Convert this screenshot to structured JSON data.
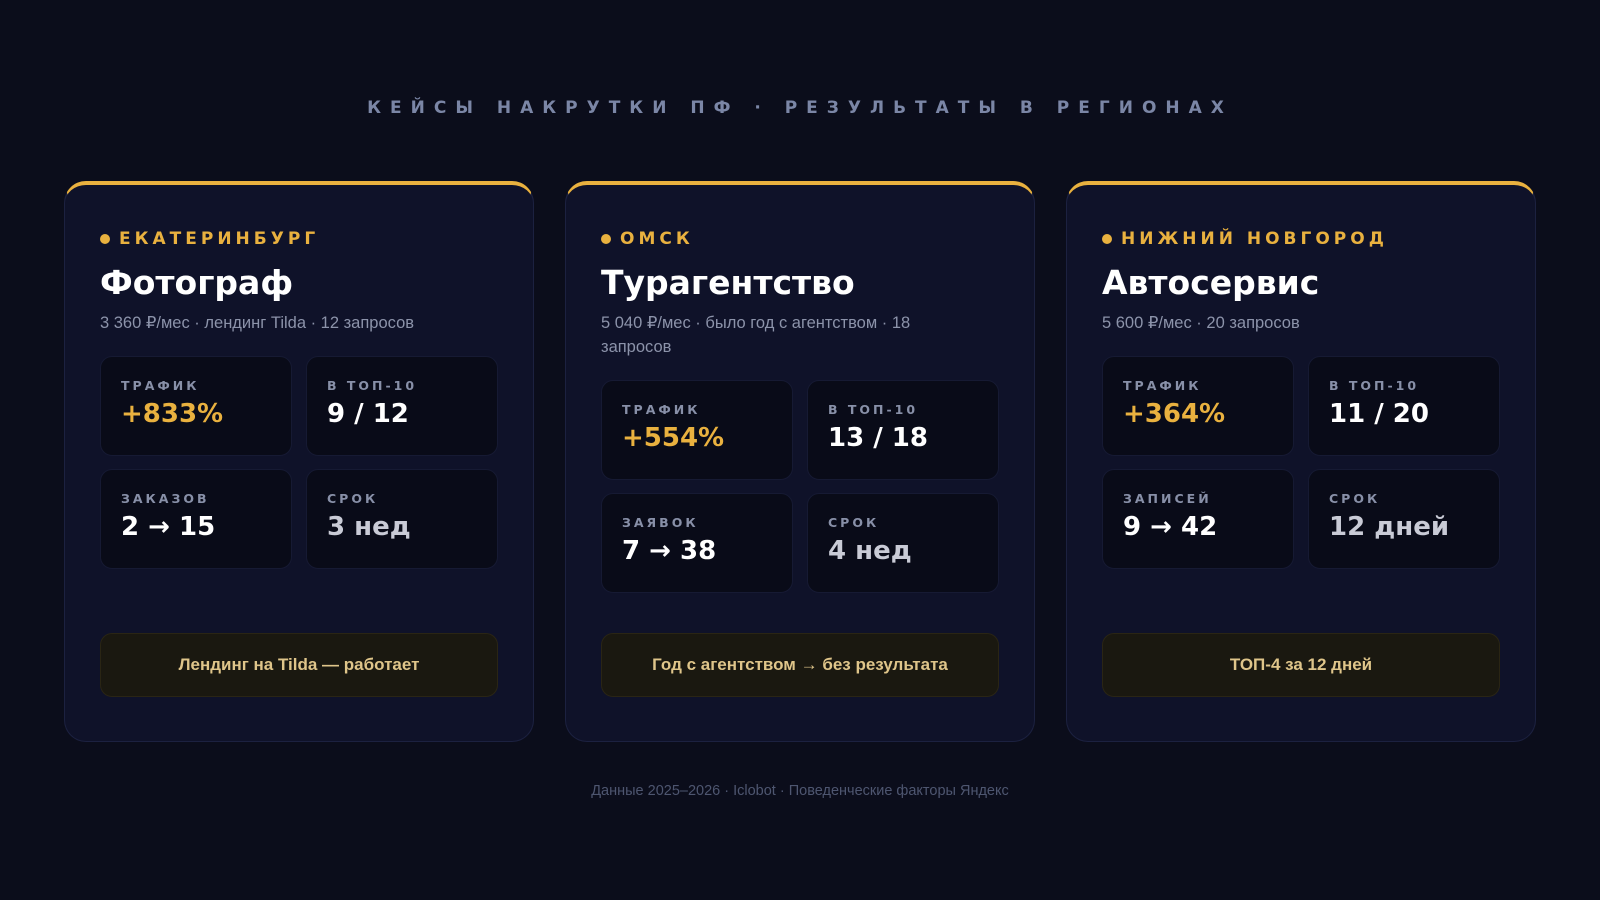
{
  "heading": "КЕЙСЫ НАКРУТКИ ПФ · РЕЗУЛЬТАТЫ В РЕГИОНАХ",
  "colors": {
    "accent": "#e9b13f",
    "background": "#0b0d1b",
    "card": "#0f1229"
  },
  "cards": [
    {
      "city": "ЕКАТЕРИНБУРГ",
      "title": "Фотограф",
      "subtitle": "3 360 ₽/мес · лендинг Tilda · 12 запросов",
      "stats": [
        {
          "label": "ТРАФИК",
          "value": "+833%"
        },
        {
          "label": "В ТОП-10",
          "value": "9 / 12"
        },
        {
          "label": "ЗАКАЗОВ",
          "value": "2 → 15"
        },
        {
          "label": "СРОК",
          "value": "3 нед"
        }
      ],
      "result": "Лендинг на Tilda — работает"
    },
    {
      "city": "ОМСК",
      "title": "Турагентство",
      "subtitle": "5 040 ₽/мес · было год с агентством · 18 запросов",
      "stats": [
        {
          "label": "ТРАФИК",
          "value": "+554%"
        },
        {
          "label": "В ТОП-10",
          "value": "13 / 18"
        },
        {
          "label": "ЗАЯВОК",
          "value": "7 → 38"
        },
        {
          "label": "СРОК",
          "value": "4 нед"
        }
      ],
      "result": "Год с агентством → без результата"
    },
    {
      "city": "НИЖНИЙ НОВГОРОД",
      "title": "Автосервис",
      "subtitle": "5 600 ₽/мес · 20 запросов",
      "stats": [
        {
          "label": "ТРАФИК",
          "value": "+364%"
        },
        {
          "label": "В ТОП-10",
          "value": "11 / 20"
        },
        {
          "label": "ЗАПИСЕЙ",
          "value": "9 → 42"
        },
        {
          "label": "СРОК",
          "value": "12 дней"
        }
      ],
      "result": "ТОП-4 за 12 дней"
    }
  ],
  "footer": "Данные 2025–2026 · Iclobot · Поведенческие факторы Яндекс"
}
